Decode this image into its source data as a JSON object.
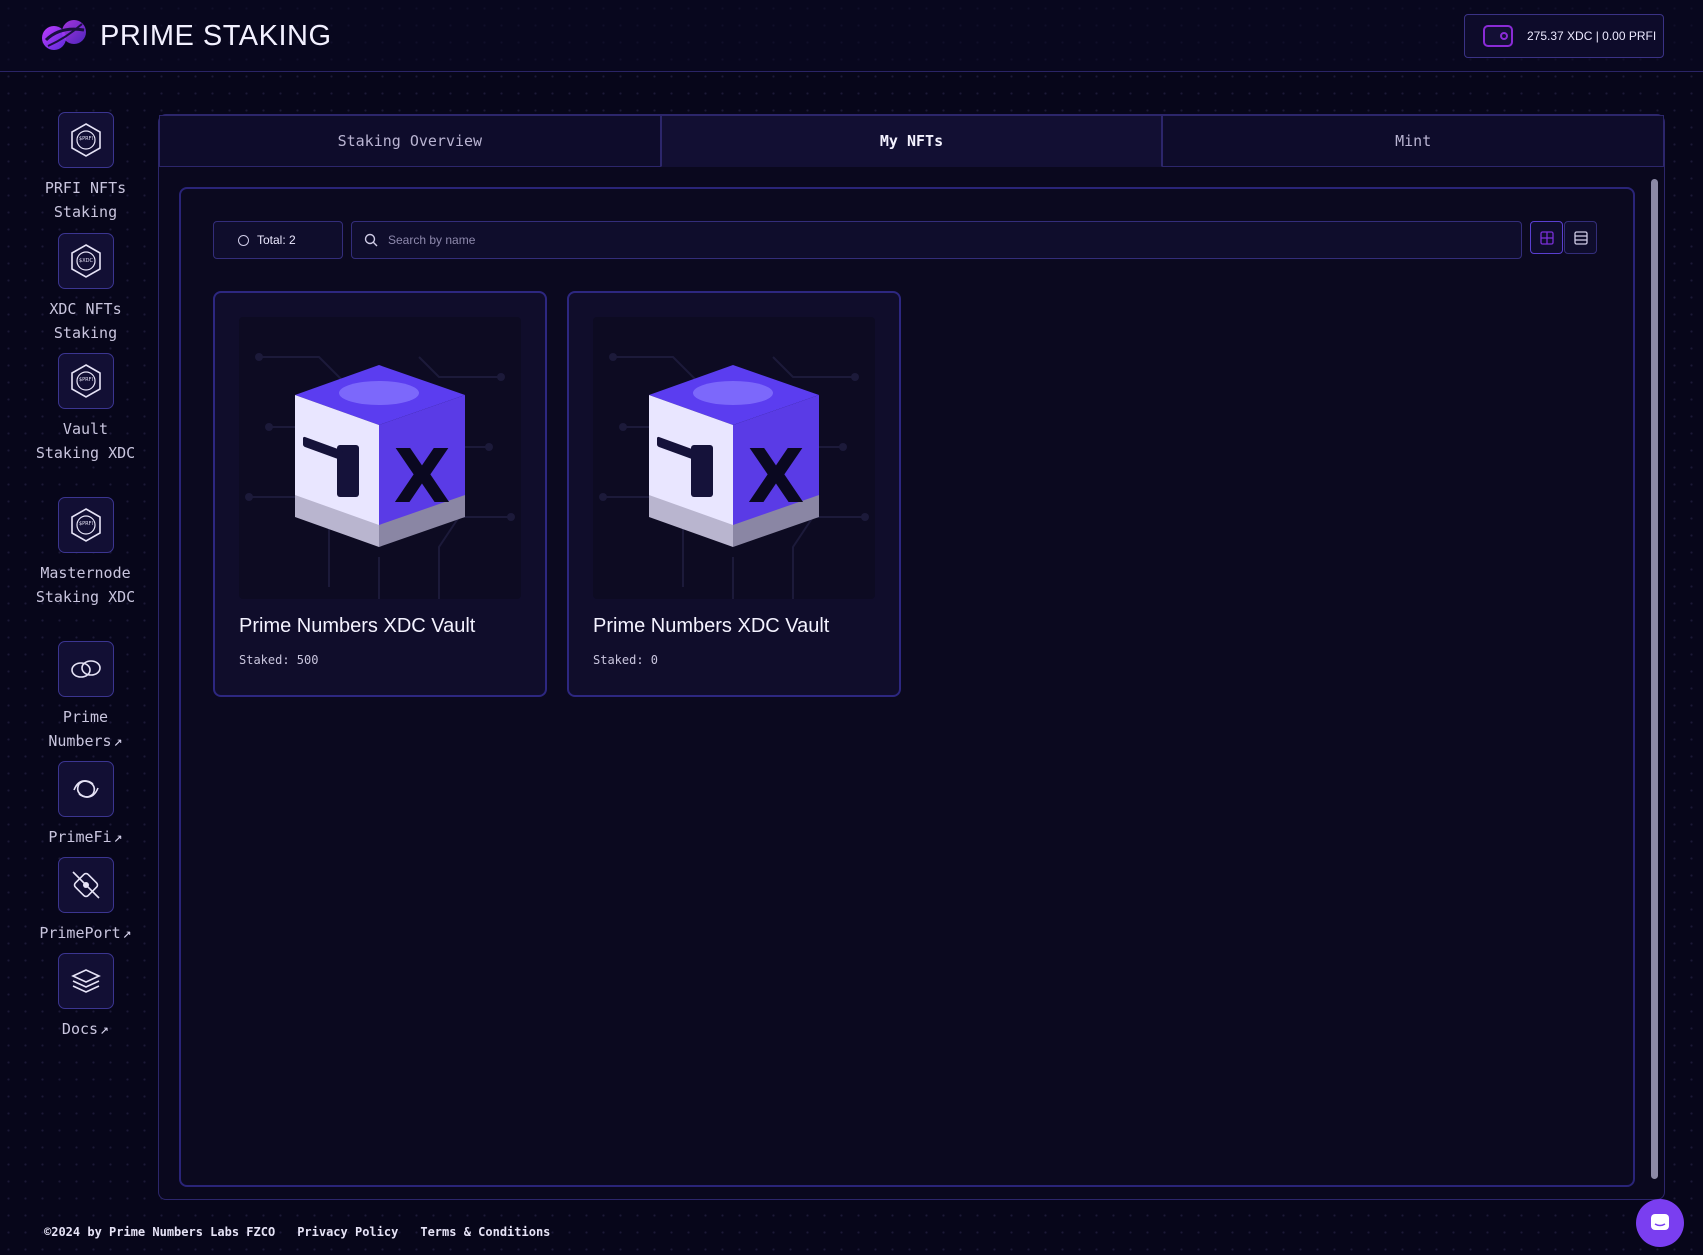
{
  "header": {
    "brand": "PRIME STAKING",
    "wallet_balance": "275.37 XDC | 0.00 PRFI"
  },
  "sidebar": {
    "items": [
      {
        "label": "PRFI NFTs Staking",
        "external": false,
        "icon": "prfi-token-icon"
      },
      {
        "label": "XDC NFTs Staking",
        "external": false,
        "icon": "xdc-token-icon"
      },
      {
        "label": "Vault Staking XDC",
        "external": false,
        "icon": "prfi-token-icon"
      },
      {
        "label": "Masternode Staking XDC",
        "external": false,
        "icon": "prfi-token-icon"
      },
      {
        "label": "Prime Numbers",
        "external": true,
        "icon": "prime-numbers-icon"
      },
      {
        "label": "PrimeFi",
        "external": true,
        "icon": "primefi-icon"
      },
      {
        "label": "PrimePort",
        "external": true,
        "icon": "primeport-icon"
      },
      {
        "label": "Docs",
        "external": true,
        "icon": "docs-stack-icon"
      }
    ],
    "external_arrow": "↗"
  },
  "tabs": [
    {
      "label": "Staking Overview",
      "active": false
    },
    {
      "label": "My NFTs",
      "active": true
    },
    {
      "label": "Mint",
      "active": false
    }
  ],
  "toolbar": {
    "total_label": "Total: 2",
    "search_placeholder": "Search by name",
    "view_modes": [
      "grid-view-icon",
      "list-view-icon"
    ],
    "active_view": "grid"
  },
  "nfts": [
    {
      "name": "Prime Numbers XDC Vault",
      "staked": "Staked: 500"
    },
    {
      "name": "Prime Numbers XDC Vault",
      "staked": "Staked: 0"
    }
  ],
  "footer": {
    "copyright": "©2024 by Prime Numbers Labs FZCO",
    "privacy": "Privacy Policy",
    "terms": "Terms & Conditions"
  },
  "colors": {
    "background": "#07061a",
    "accent": "#7a3ef0",
    "border": "#2c266b",
    "vault_purple": "#5b3df0"
  }
}
